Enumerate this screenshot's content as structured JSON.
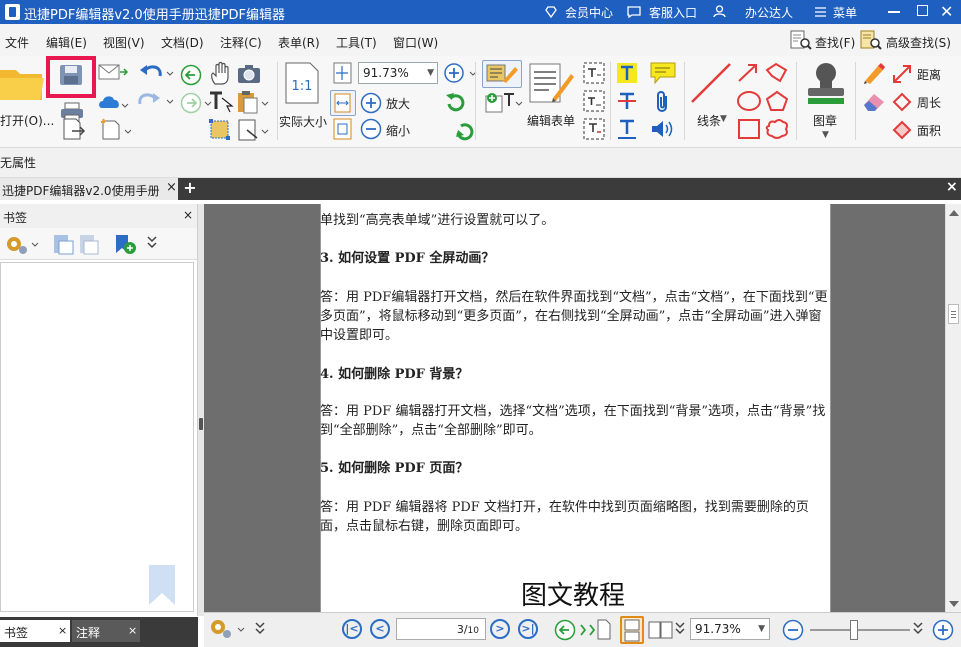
{
  "window": {
    "title": "迅捷PDF编辑器v2.0使用手册迅捷PDF编辑器",
    "member": "会员中心",
    "support": "客服入口",
    "office": "办公达人",
    "menu": "菜单"
  },
  "menubar": {
    "items": [
      "文件",
      "编辑(E)",
      "视图(V)",
      "文档(D)",
      "注释(C)",
      "表单(R)",
      "工具(T)",
      "窗口(W)"
    ],
    "search": "查找(F)",
    "advanced_search": "高级查找(S)"
  },
  "ribbon": {
    "open": "打开(O)...",
    "zoom": "91.73%",
    "actual_size": "实际大小",
    "zoom_in": "放大",
    "zoom_out": "缩小",
    "edit_form": "编辑表单",
    "line": "线条",
    "stamp": "图章",
    "distance": "距离",
    "perimeter": "周长",
    "area": "面积"
  },
  "properties": {
    "label": "无属性"
  },
  "tabs": {
    "doc_tab": "迅捷PDF编辑器v2.0使用手册",
    "close": "×",
    "add": "+"
  },
  "sidebar": {
    "title": "书签",
    "close": "×"
  },
  "bottom_tabs": {
    "bookmarks": "书签",
    "annotations": "注释",
    "close": "×"
  },
  "document": {
    "p0": "单找到“高亮表单域”进行设置就可以了。",
    "q3": "3.  如何设置 PDF 全屏动画？",
    "a3": "答：用 PDF编辑器打开文档，然后在软件界面找到“文档”，点击“文档”，在下面找到“更多页面”，将鼠标移动到“更多页面”，在右侧找到“全屏动画”，点击“全屏动画”进入弹窗中设置即可。",
    "q4": "4.  如何删除 PDF 背景？",
    "a4": "答：用 PDF 编辑器打开文档，选择“文档”选项，在下面找到“背景”选项，点击“背景”找到“全部删除”，点击“全部删除”即可。",
    "q5": "5.  如何删除 PDF 页面？",
    "a5": "答：用 PDF 编辑器将 PDF 文档打开，在软件中找到页面缩略图，找到需要删除的页面，点击鼠标右键，删除页面即可。",
    "heading": "图文教程"
  },
  "nav": {
    "page_current": "3",
    "page_total": "10",
    "zoom": "91.73%"
  },
  "colors": {
    "titlebar": "#1f5fbf",
    "highlight": "#e8174f",
    "accent_blue": "#2b6cc4"
  }
}
